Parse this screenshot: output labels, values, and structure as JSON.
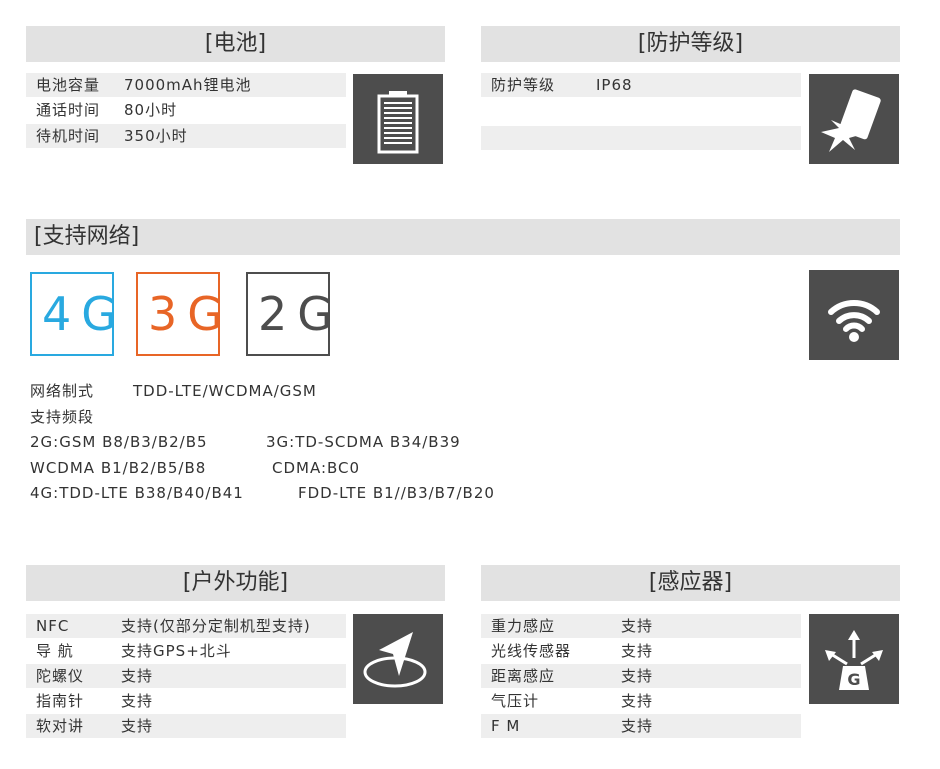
{
  "battery": {
    "title": "[电池]",
    "rows": [
      {
        "k": "电池容量",
        "v": "7000mAh锂电池"
      },
      {
        "k": "通话时间",
        "v": "80小时"
      },
      {
        "k": "待机时间",
        "v": "350小时"
      }
    ],
    "icon": "battery-icon"
  },
  "protection": {
    "title": "[防护等级]",
    "rows": [
      {
        "k": "防护等级",
        "v": "IP68"
      }
    ],
    "icon": "drop-impact-icon"
  },
  "network": {
    "title": "[支持网络]",
    "badges": [
      {
        "label": "4G",
        "color": "#29a9e0"
      },
      {
        "label": "3G",
        "color": "#e86526"
      },
      {
        "label": "2G",
        "color": "#4d4d4d"
      }
    ],
    "icon": "wifi-icon",
    "lines": [
      {
        "a": "网络制式",
        "b": "TDD-LTE/WCDMA/GSM"
      },
      {
        "a": "支持频段",
        "b": ""
      },
      {
        "a": "2G:GSM B8/B3/B2/B5",
        "b": "3G:TD-SCDMA B34/B39"
      },
      {
        "a": "WCDMA B1/B2/B5/B8",
        "b": "CDMA:BC0"
      },
      {
        "a": "4G:TDD-LTE B38/B40/B41",
        "b": "FDD-LTE B1//B3/B7/B20"
      }
    ]
  },
  "outdoor": {
    "title": "[户外功能]",
    "rows": [
      {
        "k": "NFC",
        "v": "支持(仅部分定制机型支持)"
      },
      {
        "k": "导 航",
        "v": "支持GPS+北斗"
      },
      {
        "k": "陀螺仪",
        "v": "支持"
      },
      {
        "k": "指南针",
        "v": "支持"
      },
      {
        "k": "软对讲",
        "v": "支持"
      }
    ],
    "icon": "compass-icon"
  },
  "sensors": {
    "title": "[感应器]",
    "rows": [
      {
        "k": "重力感应",
        "v": "支持"
      },
      {
        "k": "光线传感器",
        "v": "支持"
      },
      {
        "k": "距离感应",
        "v": "支持"
      },
      {
        "k": "气压计",
        "v": "支持"
      },
      {
        "k": "F M",
        "v": "支持"
      }
    ],
    "icon": "gravity-sensor-icon",
    "icon_letter": "G"
  }
}
